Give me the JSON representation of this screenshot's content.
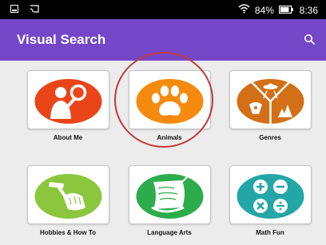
{
  "status_bar": {
    "battery": "84%",
    "time": "8:36"
  },
  "app_bar": {
    "title": "Visual Search"
  },
  "categories": [
    {
      "label": "About Me"
    },
    {
      "label": "Animals"
    },
    {
      "label": "Genres"
    },
    {
      "label": "Hobbies & How To"
    },
    {
      "label": "Language Arts"
    },
    {
      "label": "Math Fun"
    }
  ],
  "colors": {
    "app_bar": "#7447c9",
    "about_me": "#e94518",
    "animals": "#f58a0e",
    "genres": "#d36f16",
    "hobbies": "#8bc63d",
    "language_arts": "#2dac4c",
    "math_fun": "#23a7a6",
    "highlight_ring": "#c23a3a"
  },
  "icons": [
    "image-icon",
    "cast-icon",
    "wifi-icon",
    "battery-icon",
    "search-icon",
    "person-magnifier-icon",
    "paw-icon",
    "genres-collage-icon",
    "hammer-hand-icon",
    "verbs-scroll-icon",
    "math-operators-icon"
  ]
}
